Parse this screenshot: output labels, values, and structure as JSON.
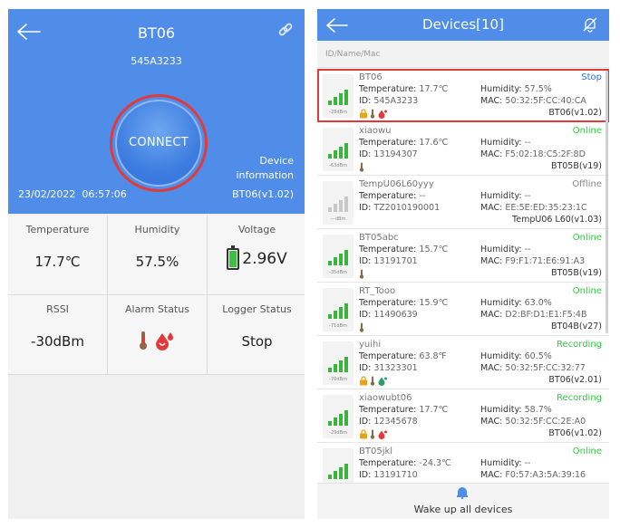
{
  "detail": {
    "title": "BT06",
    "subtitle": "545A3233",
    "connect_label": "CONNECT",
    "device_info_line1": "Device",
    "device_info_line2": "information",
    "datetime": "23/02/2022  06:57:06",
    "model": "BT06(v1.02)",
    "cells": {
      "temperature_label": "Temperature",
      "temperature_value": "17.7℃",
      "humidity_label": "Humidity",
      "humidity_value": "57.5%",
      "voltage_label": "Voltage",
      "voltage_value": "2.96V",
      "rssi_label": "RSSI",
      "rssi_value": "-30dBm",
      "alarm_label": "Alarm Status",
      "logger_label": "Logger Status",
      "logger_value": "Stop"
    }
  },
  "list_screen": {
    "title": "Devices[10]",
    "search_placeholder": "ID/Name/Mac",
    "wake_label": "Wake up all devices"
  },
  "devices": [
    {
      "name": "BT06",
      "status": "Stop",
      "temp_label": "Temperature:",
      "temp": "17.7℃",
      "hum_label": "Humidity:",
      "hum": "57.5%",
      "id_label": "ID:",
      "id": "545A3233",
      "mac_label": "MAC:",
      "mac": "50:32:5F:CC:40:CA",
      "model": "BT06(v1.02)",
      "dbm": "-28dBm"
    },
    {
      "name": "xiaowu",
      "status": "Online",
      "temp_label": "Temperature:",
      "temp": "17.6℃",
      "hum_label": "Humidity:",
      "hum": "--",
      "id_label": "ID:",
      "id": "13194307",
      "mac_label": "MAC:",
      "mac": "F5:02:18:C5:2F:8D",
      "model": "BT05B(v19)",
      "dbm": "-63dBm"
    },
    {
      "name": "TempU06L60yyy",
      "status": "Offline",
      "temp_label": "Temperature:",
      "temp": "--",
      "hum_label": "Humidity:",
      "hum": "--",
      "id_label": "ID:",
      "id": "TZ2010190001",
      "mac_label": "MAC:",
      "mac": "EE:5E:ED:35:23:1C",
      "model": "TempU06 L60(v1.03)",
      "dbm": "---dBm"
    },
    {
      "name": "BT05abc",
      "status": "Online",
      "temp_label": "Temperature:",
      "temp": "15.7℃",
      "hum_label": "Humidity:",
      "hum": "--",
      "id_label": "ID:",
      "id": "13191701",
      "mac_label": "MAC:",
      "mac": "F9:F1:71:E6:91:A3",
      "model": "BT05B(v19)",
      "dbm": "-35dBm"
    },
    {
      "name": "RT_Tooo",
      "status": "Online",
      "temp_label": "Temperature:",
      "temp": "15.9℃",
      "hum_label": "Humidity:",
      "hum": "63.0%",
      "id_label": "ID:",
      "id": "11490639",
      "mac_label": "MAC:",
      "mac": "D2:BF:D1:E1:F5:4B",
      "model": "BT04B(v27)",
      "dbm": "-71dBm"
    },
    {
      "name": "yuihi",
      "status": "Recording",
      "temp_label": "Temperature:",
      "temp": "63.8℉",
      "hum_label": "Humidity:",
      "hum": "60.5%",
      "id_label": "ID:",
      "id": "31323301",
      "mac_label": "MAC:",
      "mac": "50:32:5F:CC:32:77",
      "model": "BT06(v2.01)",
      "dbm": "-70dBm"
    },
    {
      "name": "xiaowubt06",
      "status": "Recording",
      "temp_label": "Temperature:",
      "temp": "17.7℃",
      "hum_label": "Humidity:",
      "hum": "58.7%",
      "id_label": "ID:",
      "id": "12345678",
      "mac_label": "MAC:",
      "mac": "50:32:5F:CC:2E:A0",
      "model": "BT06(v1.02)",
      "dbm": "-29dBm"
    },
    {
      "name": "BT05jkl",
      "status": "Online",
      "temp_label": "Temperature:",
      "temp": "-24.3℃",
      "hum_label": "Humidity:",
      "hum": "--",
      "id_label": "ID:",
      "id": "13191710",
      "mac_label": "MAC:",
      "mac": "F0:57:A3:5A:39:16",
      "model": "",
      "dbm": "-33dBm"
    }
  ],
  "colors": {
    "accent": "#4f8de8",
    "highlight": "#e23a3a",
    "online": "#2ecc40",
    "stop": "#2f6fd6"
  }
}
